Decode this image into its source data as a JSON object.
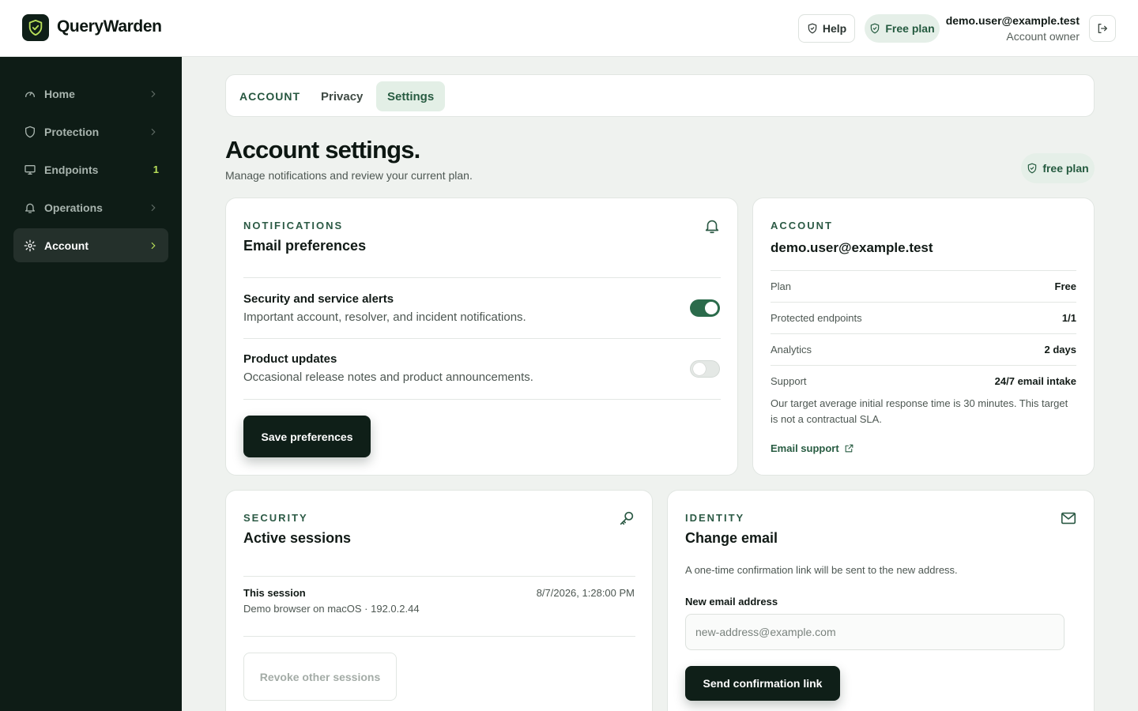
{
  "app": {
    "brand": "QueryWarden",
    "colors": {
      "accent": "#2b6b4b",
      "sidebar_bg": "#0e1c16",
      "dark_button": "#0f1f18"
    }
  },
  "header": {
    "help_label": "Help",
    "plan_label": "Free plan",
    "user_email": "demo.user@example.test",
    "user_role": "Account owner"
  },
  "sidebar": {
    "items": [
      {
        "label": "Home",
        "icon": "gauge-icon"
      },
      {
        "label": "Protection",
        "icon": "shield-icon"
      },
      {
        "label": "Endpoints",
        "icon": "monitor-icon",
        "badge": "1"
      },
      {
        "label": "Operations",
        "icon": "bell-icon"
      },
      {
        "label": "Account",
        "icon": "gear-icon",
        "active": true
      }
    ]
  },
  "tabs": [
    {
      "label": "ACCOUNT"
    },
    {
      "label": "Privacy"
    },
    {
      "label": "Settings",
      "active": true
    }
  ],
  "page": {
    "title": "Account settings.",
    "subtitle": "Manage notifications and review your current plan.",
    "plan_badge": "free plan"
  },
  "notifications": {
    "eyebrow": "NOTIFICATIONS",
    "title": "Email preferences",
    "prefs": [
      {
        "title": "Security and service alerts",
        "desc": "Important account, resolver, and incident notifications.",
        "enabled": true
      },
      {
        "title": "Product updates",
        "desc": "Occasional release notes and product announcements.",
        "enabled": false
      }
    ],
    "save_label": "Save preferences"
  },
  "account": {
    "eyebrow": "ACCOUNT",
    "email": "demo.user@example.test",
    "rows": [
      {
        "label": "Plan",
        "value": "Free"
      },
      {
        "label": "Protected endpoints",
        "value": "1/1"
      },
      {
        "label": "Analytics",
        "value": "2 days"
      },
      {
        "label": "Support",
        "value": "24/7 email intake"
      }
    ],
    "support_note": "Our target average initial response time is 30 minutes. This target is not a contractual SLA.",
    "support_link": "Email support"
  },
  "security": {
    "eyebrow": "SECURITY",
    "title": "Active sessions",
    "session": {
      "title": "This session",
      "desc": "Demo browser on macOS · 192.0.2.44",
      "time": "8/7/2026, 1:28:00 PM"
    },
    "revoke_label": "Revoke other sessions"
  },
  "identity": {
    "eyebrow": "IDENTITY",
    "title": "Change email",
    "desc": "A one-time confirmation link will be sent to the new address.",
    "field_label": "New email address",
    "placeholder": "new-address@example.com",
    "value": "",
    "send_label": "Send confirmation link"
  }
}
